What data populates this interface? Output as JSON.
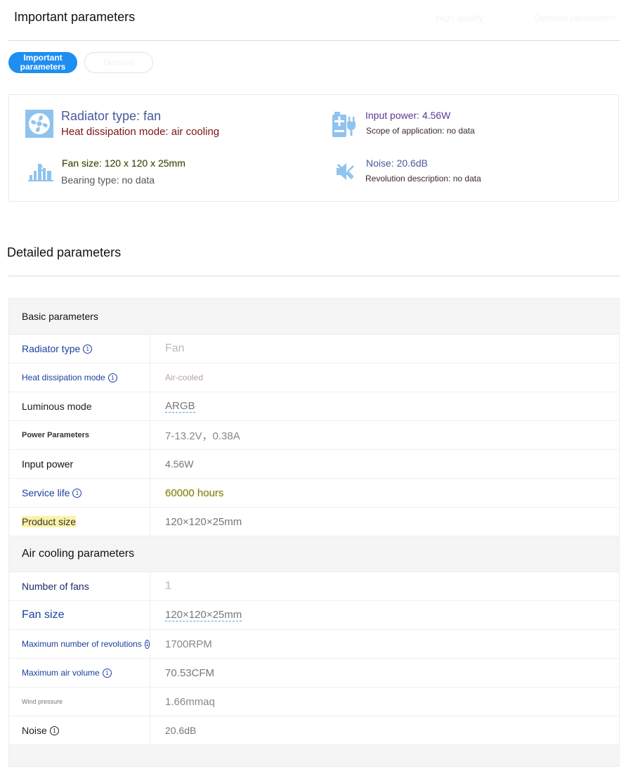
{
  "important": {
    "title": "Important parameters",
    "top_right_link": "High quality",
    "top_right_link2": "Detailed parameters",
    "tabs": [
      {
        "label": "Important parameters"
      },
      {
        "label": "Detailed"
      }
    ],
    "summary": {
      "radiator_type": "Radiator type: fan",
      "heat_mode": "Heat dissipation mode: air cooling",
      "input_power": "Input power: 4.56W",
      "scope": "Scope of application: no data",
      "fan_size": "Fan size: 120 x 120 x 25mm",
      "bearing": "Bearing type: no data",
      "noise": "Noise: 20.6dB",
      "revolution": "Revolution description: no data"
    }
  },
  "detailed": {
    "title": "Detailed parameters",
    "info_glyph": "①",
    "groups": [
      {
        "name": "Basic parameters",
        "rows": [
          {
            "key": "Radiator type",
            "value": "Fan"
          },
          {
            "key": "Heat dissipation mode",
            "value": "Air-cooled"
          },
          {
            "key": "Luminous mode",
            "value": "ARGB"
          },
          {
            "key": "Power Parameters",
            "value": "7-13.2V，0.38A"
          },
          {
            "key": "Input power",
            "value": "4.56W"
          },
          {
            "key": "Service life",
            "value": "60000 hours"
          },
          {
            "key": "Product size",
            "value": "120×120×25mm"
          }
        ]
      },
      {
        "name": "Air cooling parameters",
        "rows": [
          {
            "key": "Number of fans",
            "value": "1"
          },
          {
            "key": "Fan size",
            "value": "120×120×25mm"
          },
          {
            "key": "Maximum number of revolutions",
            "value": "1700RPM"
          },
          {
            "key": "Maximum air volume",
            "value": "70.53CFM"
          },
          {
            "key": "Wind pressure",
            "value": "1.66mmaq"
          },
          {
            "key": "Noise",
            "value": "20.6dB"
          }
        ]
      }
    ]
  },
  "colors": {
    "accent": "#1f8ef1",
    "link_blue": "#1a3fa0",
    "icon_blue": "#8fc3ef",
    "dark_red": "#7a1212",
    "purple": "#5a3a9a"
  }
}
